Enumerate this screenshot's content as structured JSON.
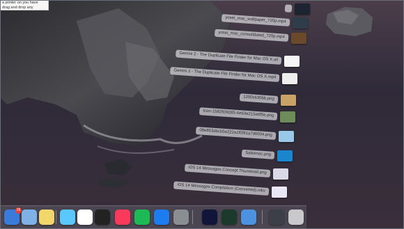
{
  "tooltip": {
    "lines": [
      "a printer on you have",
      "drag and drop any"
    ]
  },
  "stack": {
    "items": [
      {
        "label": "",
        "thumb_color": "#1b2430"
      },
      {
        "label": "yosei_mac_wallpaper_720p.mp4",
        "thumb_color": "#2f3c49"
      },
      {
        "label": "yosei_mac_consolidated_720p.mp4",
        "thumb_color": "#6a4a2b"
      },
      {
        "label": "Gemini 2 - The Duplicate File Finder for Mac OS X.url",
        "thumb_color": "#f5f5f5"
      },
      {
        "label": "Gemini 2 - The Duplicate File Finder for Mac OS X.mp4",
        "thumb_color": "#eeeeee"
      },
      {
        "label": "1200x630bb.png",
        "thumb_color": "#c8a266"
      },
      {
        "label": "Icon-1582939285-6e63e215e6f0e.png",
        "thumb_color": "#6e8b5a"
      },
      {
        "label": "08e853d6cb5e222a1f5f91a7d0004.png",
        "thumb_color": "#9ac8e8"
      },
      {
        "label": "SafeImac.png",
        "thumb_color": "#1a86d0"
      },
      {
        "label": "iOS 14 Messages Concept Thumbnail.png",
        "thumb_color": "#d9d9e8"
      },
      {
        "label": "iOS 14 Messages Compilation (Converted).mkv",
        "thumb_color": "#e9e6f6"
      }
    ]
  },
  "dock": {
    "icons": [
      {
        "name": "mail-app-icon",
        "color": "#3a7ad9",
        "badge": "29"
      },
      {
        "name": "preview-app-icon",
        "color": "#7fb1e6",
        "badge": ""
      },
      {
        "name": "notes-app-icon",
        "color": "#f1d76b",
        "badge": ""
      },
      {
        "name": "messages-app-icon",
        "color": "#5ac8fa",
        "badge": ""
      },
      {
        "name": "slack-app-icon",
        "color": "#ffffff",
        "badge": ""
      },
      {
        "name": "final-cut-pro-app-icon",
        "color": "#222222",
        "badge": ""
      },
      {
        "name": "music-app-icon",
        "color": "#fa3a5b",
        "badge": ""
      },
      {
        "name": "spotify-app-icon",
        "color": "#1db954",
        "badge": ""
      },
      {
        "name": "app-store-app-icon",
        "color": "#1c7cf0",
        "badge": ""
      },
      {
        "name": "system-preferences-app-icon",
        "color": "#8a8d92",
        "badge": ""
      },
      {
        "name": "dashlane-app-icon",
        "color": "#11153a",
        "badge": ""
      },
      {
        "name": "activity-monitor-app-icon",
        "color": "#1c3a2b",
        "badge": ""
      },
      {
        "name": "photos-folder-icon",
        "color": "#4d92e0",
        "badge": ""
      },
      {
        "name": "downloads-stack-icon",
        "color": "#3c3f47",
        "badge": ""
      },
      {
        "name": "trash-icon",
        "color": "#c9c9cc",
        "badge": ""
      }
    ]
  }
}
